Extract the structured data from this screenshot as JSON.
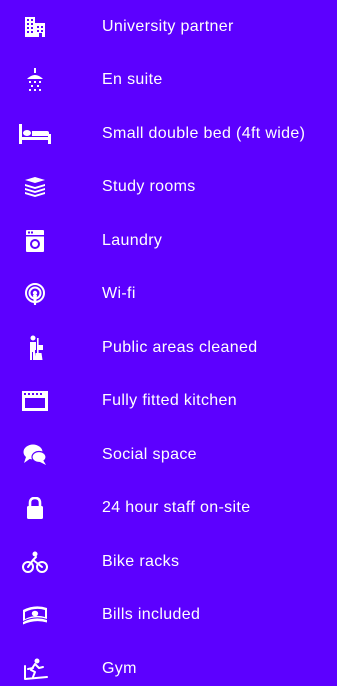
{
  "colors": {
    "background": "#5C00FF",
    "foreground": "#FFFFFF"
  },
  "amenities": [
    {
      "label": "University partner",
      "icon": "building-icon"
    },
    {
      "label": "En suite",
      "icon": "shower-icon"
    },
    {
      "label": "Small double bed (4ft wide)",
      "icon": "bed-icon"
    },
    {
      "label": "Study rooms",
      "icon": "books-icon"
    },
    {
      "label": "Laundry",
      "icon": "washing-machine-icon"
    },
    {
      "label": "Wi-fi",
      "icon": "wifi-icon"
    },
    {
      "label": "Public areas cleaned",
      "icon": "cleaner-icon"
    },
    {
      "label": "Fully fitted kitchen",
      "icon": "oven-icon"
    },
    {
      "label": "Social space",
      "icon": "chat-bubbles-icon"
    },
    {
      "label": "24 hour staff on-site",
      "icon": "padlock-icon"
    },
    {
      "label": "Bike racks",
      "icon": "bicycle-icon"
    },
    {
      "label": "Bills included",
      "icon": "money-icon"
    },
    {
      "label": "Gym",
      "icon": "treadmill-icon"
    }
  ]
}
